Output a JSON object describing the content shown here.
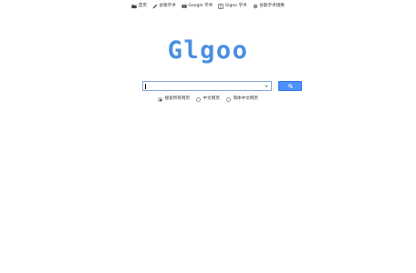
{
  "nav": {
    "items": [
      {
        "label": "首页",
        "icon": "folder-icon"
      },
      {
        "label": "谷歌学术",
        "icon": "pencil-icon"
      },
      {
        "label": "Google 学术",
        "icon": "youtube-icon"
      },
      {
        "label": "Glgoo 学术",
        "icon": "book-icon"
      },
      {
        "label": "谷歌学术镜像",
        "icon": "gear-icon"
      }
    ]
  },
  "logo": {
    "text": "Glgoo",
    "color": "#4a8fe0"
  },
  "search": {
    "value": "",
    "placeholder": "",
    "button_icon": "search-icon",
    "button_color": "#4d90fe"
  },
  "options": [
    {
      "label": "搜索所有网页",
      "checked": true
    },
    {
      "label": "中文网页",
      "checked": false
    },
    {
      "label": "简体中文网页",
      "checked": false
    }
  ]
}
